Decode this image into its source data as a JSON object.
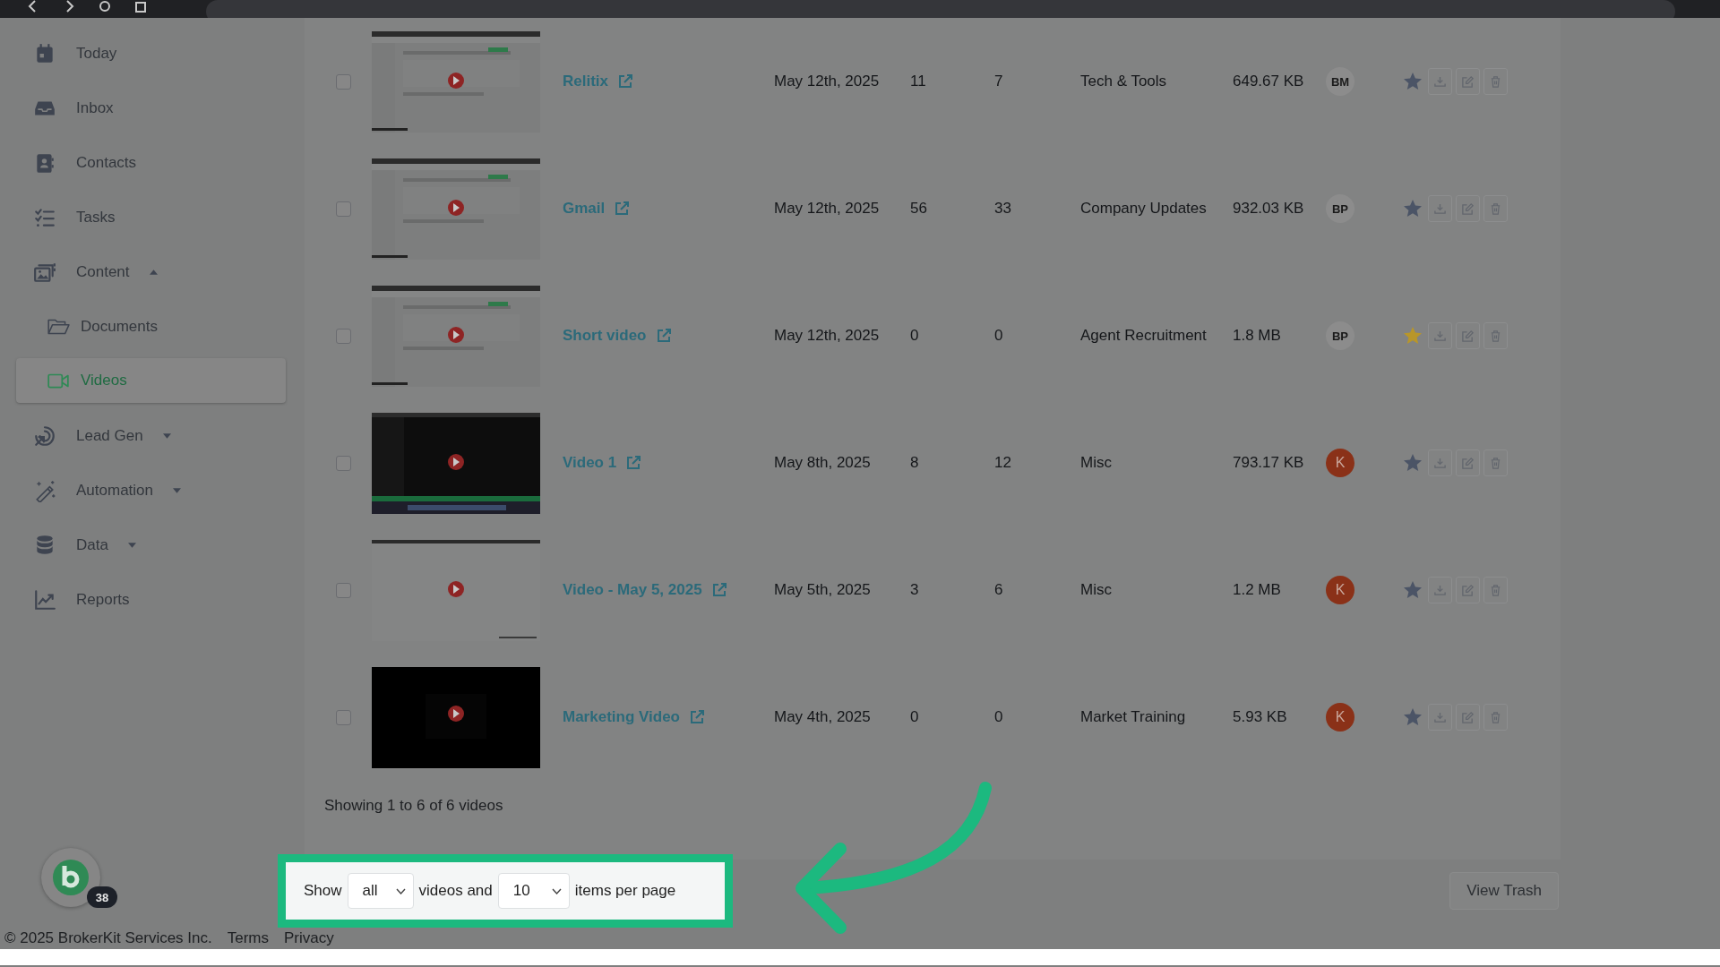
{
  "sidebar": {
    "items": [
      {
        "label": "Today",
        "kind": "link",
        "selected": false
      },
      {
        "label": "Inbox",
        "kind": "link",
        "selected": false
      },
      {
        "label": "Contacts",
        "kind": "link",
        "selected": false
      },
      {
        "label": "Tasks",
        "kind": "link",
        "selected": false
      },
      {
        "label": "Content",
        "kind": "group",
        "expanded": true,
        "selected": false,
        "children": [
          {
            "label": "Documents",
            "selected": false
          },
          {
            "label": "Videos",
            "selected": true
          }
        ]
      },
      {
        "label": "Lead Gen",
        "kind": "group",
        "expanded": false,
        "selected": false
      },
      {
        "label": "Automation",
        "kind": "group",
        "expanded": false,
        "selected": false
      },
      {
        "label": "Data",
        "kind": "group",
        "expanded": false,
        "selected": false
      },
      {
        "label": "Reports",
        "kind": "link",
        "selected": false
      }
    ]
  },
  "table": {
    "rows": [
      {
        "checked": false,
        "title": "Relitix",
        "date": "May 12th, 2025",
        "column_3": "11",
        "column_4": "7",
        "category": "Tech & Tools",
        "size": "649.67 KB",
        "avatar": {
          "initials": "BM",
          "color": "#8c8c8c"
        },
        "starred": false
      },
      {
        "checked": false,
        "title": "Gmail",
        "date": "May 12th, 2025",
        "column_3": "56",
        "column_4": "33",
        "category": "Company Updates",
        "size": "932.03 KB",
        "avatar": {
          "initials": "BP",
          "color": "#8c8c8c"
        },
        "starred": false
      },
      {
        "checked": false,
        "title": "Short video",
        "date": "May 12th, 2025",
        "column_3": "0",
        "column_4": "0",
        "category": "Agent Recruitment",
        "size": "1.8 MB",
        "avatar": {
          "initials": "BP",
          "color": "#8c8c8c"
        },
        "starred": true
      },
      {
        "checked": false,
        "title": "Video 1",
        "date": "May 8th, 2025",
        "column_3": "8",
        "column_4": "12",
        "category": "Misc",
        "size": "793.17 KB",
        "avatar": {
          "initials": "K",
          "color": "#8a3118"
        },
        "starred": false
      },
      {
        "checked": false,
        "title": "Video - May 5, 2025",
        "date": "May 5th, 2025",
        "column_3": "3",
        "column_4": "6",
        "category": "Misc",
        "size": "1.2 MB",
        "avatar": {
          "initials": "K",
          "color": "#8a3118"
        },
        "starred": false
      },
      {
        "checked": false,
        "title": "Marketing Video",
        "date": "May 4th, 2025",
        "column_3": "0",
        "column_4": "0",
        "category": "Market Training",
        "size": "5.93 KB",
        "avatar": {
          "initials": "K",
          "color": "#8a3118"
        },
        "starred": false
      }
    ],
    "summary": "Showing 1 to 6 of 6 videos"
  },
  "pagination": {
    "highlighted": true,
    "show_label": "Show",
    "filter": "all",
    "middle_label": "videos and",
    "per_page": "10",
    "end_label": "items per page"
  },
  "view_trash_button": "View Trash",
  "app_badge": "38",
  "footer": {
    "copyright": "© 2025 BrokerKit Services Inc.",
    "links": [
      "Terms",
      "Privacy"
    ]
  }
}
